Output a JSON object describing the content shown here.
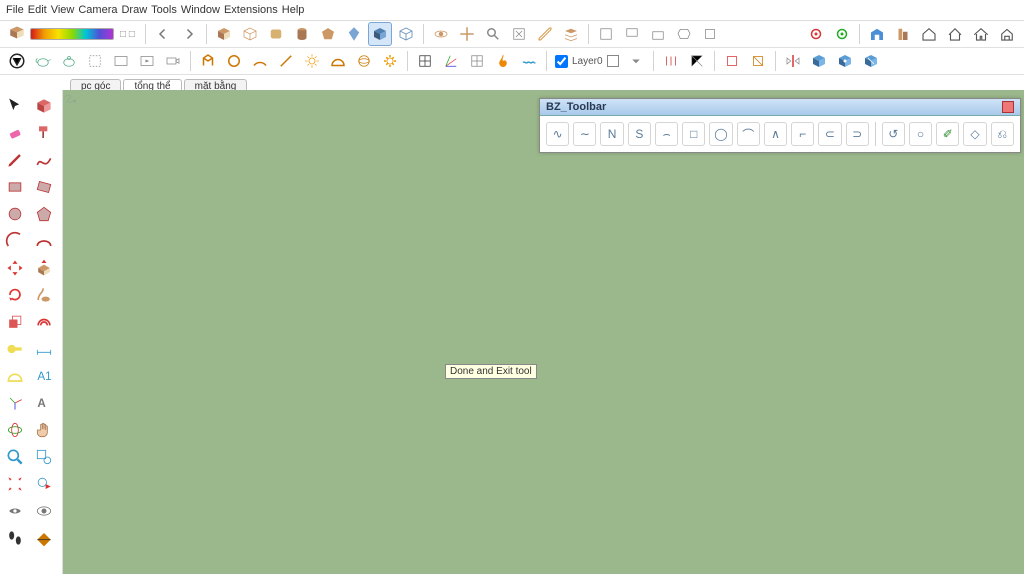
{
  "menu": {
    "items": [
      "File",
      "Edit",
      "View",
      "Camera",
      "Draw",
      "Tools",
      "Window",
      "Extensions",
      "Help"
    ]
  },
  "scene_tabs": [
    {
      "label": "pc góc",
      "active": false
    },
    {
      "label": "tổng thể",
      "active": true
    },
    {
      "label": "mặt bằng",
      "active": false
    }
  ],
  "layer": {
    "label": "Layer0"
  },
  "bz_toolbar": {
    "title": "BZ_Toolbar"
  },
  "tooltip": "Done and Exit tool",
  "viewport": {
    "bg": "#9bb88c",
    "curve_color": "#2a3cc8",
    "axis_color": "#b05030",
    "tangent_color": "#d6a84a",
    "curve_dash": "10 5"
  }
}
